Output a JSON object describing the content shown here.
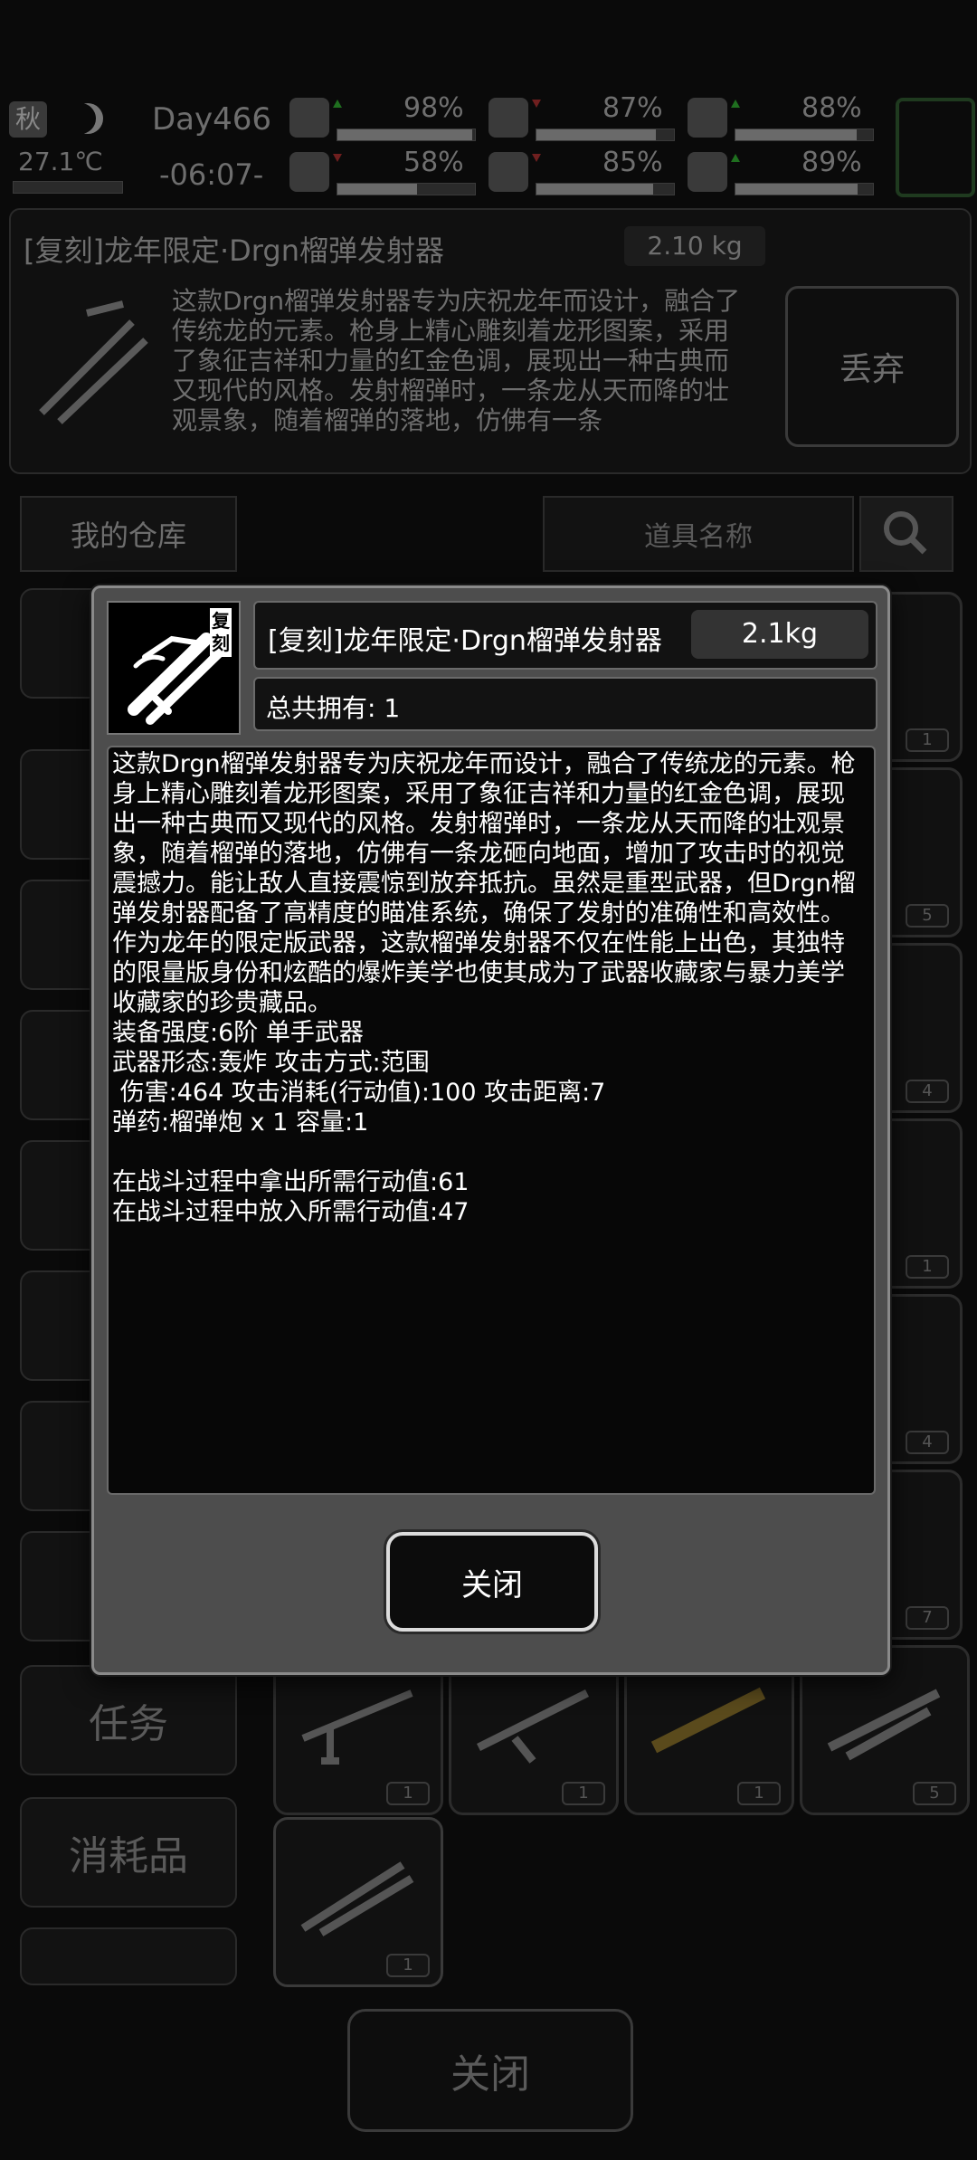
{
  "hud": {
    "season": "秋",
    "temperature": "27.1℃",
    "day": "Day466",
    "time": "-06:07-",
    "stats": [
      {
        "icon": "medkit-icon",
        "value_label": "98%",
        "level": 0.98,
        "trend": "up"
      },
      {
        "icon": "stomach-icon",
        "value_label": "87%",
        "level": 0.87,
        "trend": "down"
      },
      {
        "icon": "bladder-icon",
        "value_label": "88%",
        "level": 0.88,
        "trend": "up"
      },
      {
        "icon": "boot-icon",
        "value_label": "58%",
        "level": 0.58,
        "trend": "down"
      },
      {
        "icon": "water-drop-icon",
        "value_label": "85%",
        "level": 0.85,
        "trend": "down"
      },
      {
        "icon": "heart-icon",
        "value_label": "89%",
        "level": 0.89,
        "trend": "up"
      }
    ]
  },
  "background": {
    "item_title": "[复刻]龙年限定·Drgn榴弹发射器",
    "item_weight": "2.10 kg",
    "item_desc_preview": "这款Drgn榴弹发射器专为庆祝龙年而设计，融合了传统龙的元素。枪身上精心雕刻着龙形图案，采用了象征吉祥和力量的红金色调，展现出一种古典而又现代的风格。发射榴弹时，一条龙从天而降的壮观景象，随着榴弹的落地，仿佛有一条",
    "discard_label": "丢弃",
    "warehouse_label": "我的仓库",
    "search_placeholder": "道具名称",
    "side_tabs": [
      "任务",
      "消耗品"
    ],
    "bottom_close_label": "关闭",
    "slot_counts_right": [
      "1",
      "5",
      "4",
      "1",
      "4",
      "7"
    ],
    "slot_counts_bottom": [
      "1",
      "1",
      "1",
      "5",
      "1"
    ]
  },
  "modal": {
    "title": "[复刻]龙年限定·Drgn榴弹发射器",
    "weight": "2.1kg",
    "owned": "总共拥有:  1",
    "icon_badge": "复刻",
    "description": "这款Drgn榴弹发射器专为庆祝龙年而设计，融合了传统龙的元素。枪身上精心雕刻着龙形图案，采用了象征吉祥和力量的红金色调，展现出一种古典而又现代的风格。发射榴弹时，一条龙从天而降的壮观景象，随着榴弹的落地，仿佛有一条龙砸向地面，增加了攻击时的视觉震撼力。能让敌人直接震惊到放弃抵抗。虽然是重型武器，但Drgn榴弹发射器配备了高精度的瞄准系统，确保了发射的准确性和高效性。作为龙年的限定版武器，这款榴弹发射器不仅在性能上出色，其独特的限量版身份和炫酷的爆炸美学也使其成为了武器收藏家与暴力美学收藏家的珍贵藏品。\n装备强度:6阶 单手武器\n武器形态:轰炸 攻击方式:范围\n 伤害:464 攻击消耗(行动值):100 攻击距离:7\n弹药:榴弹炮 x 1 容量:1\n\n在战斗过程中拿出所需行动值:61\n在战斗过程中放入所需行动值:47",
    "close_label": "关闭"
  }
}
